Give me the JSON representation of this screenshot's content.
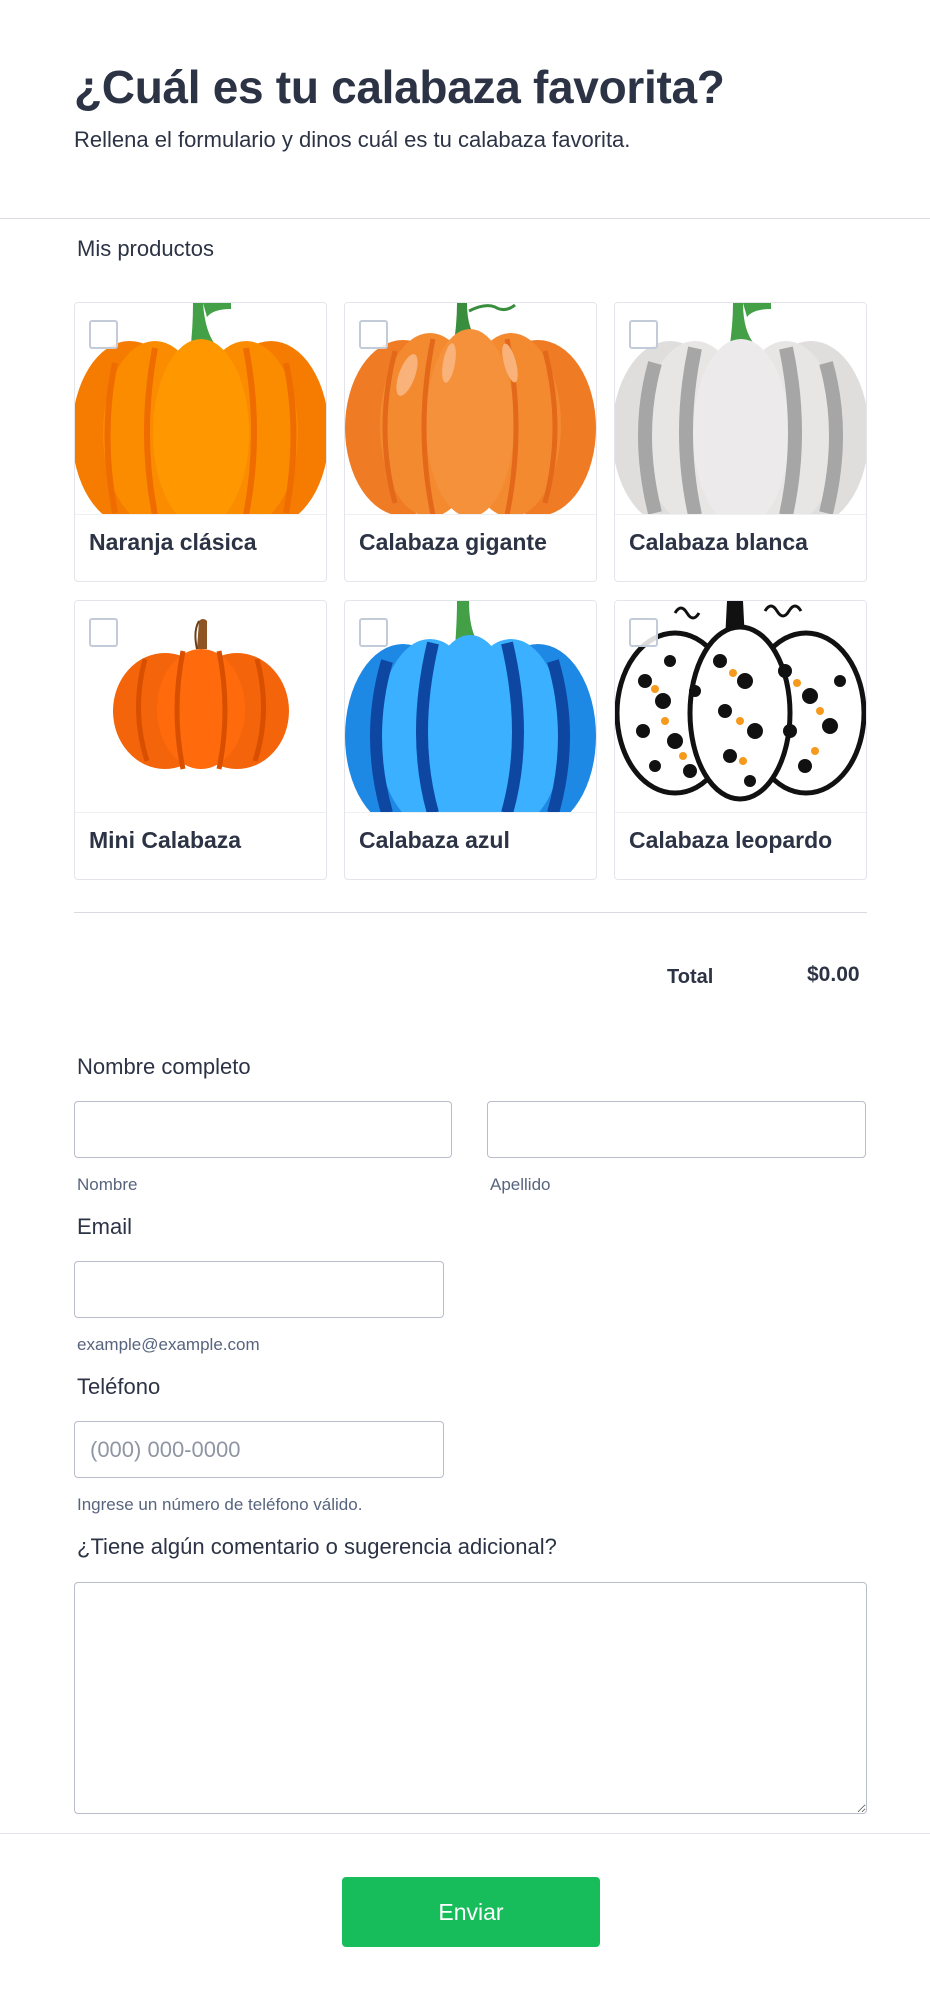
{
  "header": {
    "title": "¿Cuál es tu calabaza favorita?",
    "subtitle": "Rellena el formulario y dinos cuál es tu calabaza favorita."
  },
  "products": {
    "label": "Mis productos",
    "items": [
      {
        "name": "Naranja clásica",
        "selected": false
      },
      {
        "name": "Calabaza gigante",
        "selected": false
      },
      {
        "name": "Calabaza blanca",
        "selected": false
      },
      {
        "name": "Mini Calabaza",
        "selected": false
      },
      {
        "name": "Calabaza azul",
        "selected": false
      },
      {
        "name": "Calabaza leopardo",
        "selected": false
      }
    ],
    "total_label": "Total",
    "total_value": "$0.00"
  },
  "form": {
    "full_name": {
      "label": "Nombre completo",
      "first_sublabel": "Nombre",
      "last_sublabel": "Apellido",
      "first_value": "",
      "last_value": ""
    },
    "email": {
      "label": "Email",
      "value": "",
      "sublabel": "example@example.com"
    },
    "phone": {
      "label": "Teléfono",
      "value": "",
      "placeholder": "(000) 000-0000",
      "sublabel": "Ingrese un número de teléfono válido."
    },
    "comments": {
      "label": "¿Tiene algún comentario o sugerencia adicional?",
      "value": ""
    },
    "submit_label": "Enviar"
  },
  "colors": {
    "text": "#2c3345",
    "submit": "#18bd5b",
    "border": "#b8bdc9"
  }
}
